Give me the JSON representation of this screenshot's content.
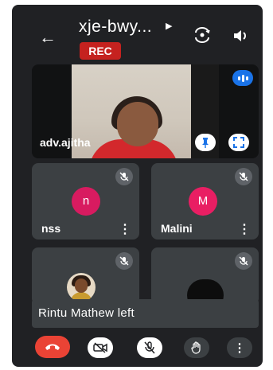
{
  "header": {
    "back_icon": "arrow-left-icon",
    "meeting_code": "xje-bwy...",
    "caret_icon": "caret-right-icon",
    "rec_badge": "REC",
    "camera_switch_icon": "camera-switch-icon",
    "speaker_icon": "speaker-icon"
  },
  "main_tile": {
    "name": "adv.ajitha",
    "audio_icon": "audio-level-icon",
    "pin_icon": "pin-icon",
    "fullscreen_icon": "fullscreen-icon"
  },
  "participants": [
    {
      "initial": "n",
      "name": "nss",
      "muted": true,
      "avatar_color": "#d81b60"
    },
    {
      "initial": "M",
      "name": "Malini",
      "muted": true,
      "avatar_color": "#e91e63"
    },
    {
      "name": "",
      "muted": true,
      "avatar": "photo"
    },
    {
      "name": "",
      "muted": true,
      "avatar": "dark"
    }
  ],
  "toast": "Rintu Mathew left",
  "controls": {
    "hangup_icon": "phone-hangup-icon",
    "camera_icon": "camera-off-icon",
    "mic_icon": "mic-off-icon",
    "raise_hand_icon": "raise-hand-icon",
    "more_label": "⋮"
  },
  "colors": {
    "background": "#202124",
    "tile": "#3c4043",
    "rec": "#c5221f",
    "hangup": "#ea4335",
    "accent_blue": "#1a73e8"
  }
}
